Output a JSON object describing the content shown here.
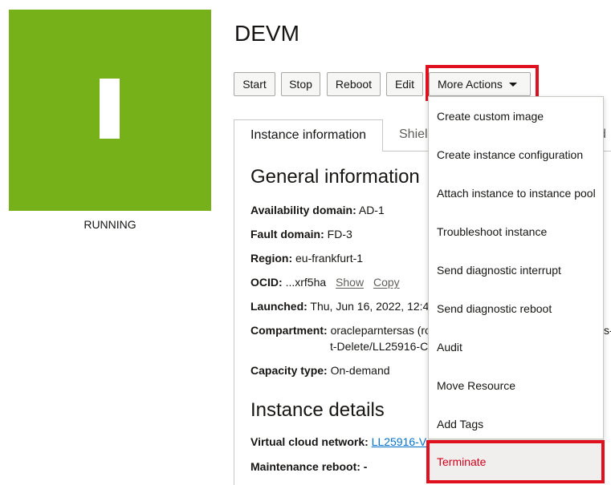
{
  "colors": {
    "status_tile": "#76b11a",
    "highlight": "#e0101e",
    "danger": "#d1001e",
    "link": "#0572ce"
  },
  "instance": {
    "title": "DEVM",
    "status": "RUNNING",
    "status_icon": "instance-running-icon"
  },
  "toolbar": {
    "start": "Start",
    "stop": "Stop",
    "reboot": "Reboot",
    "edit": "Edit",
    "more_actions": "More Actions",
    "more_actions_icon": "caret-down-icon"
  },
  "tabs": {
    "active": "Instance information",
    "second": "Shiel",
    "third": "d"
  },
  "general": {
    "heading": "General information",
    "availability_domain_label": "Availability domain:",
    "availability_domain": "AD-1",
    "fault_domain_label": "Fault domain:",
    "fault_domain": "FD-3",
    "region_label": "Region:",
    "region": "eu-frankfurt-1",
    "ocid_label": "OCID:",
    "ocid": "...xrf5ha",
    "ocid_show": "Show",
    "ocid_copy": "Copy",
    "launched_label": "Launched:",
    "launched": "Thu, Jun 16, 2022, 12:4",
    "compartment_label": "Compartment:",
    "compartment_line1": "oracleparntersas (ro",
    "compartment_line2": "t-Delete/LL25916-C",
    "compartment_overflow": "s-",
    "capacity_type_label": "Capacity type:",
    "capacity_type": "On-demand"
  },
  "details": {
    "heading": "Instance details",
    "vcn_label": "Virtual cloud network:",
    "vcn": "LL25916-V",
    "maintenance_label": "Maintenance reboot:",
    "maintenance": "-"
  },
  "menu": {
    "items": [
      "Create custom image",
      "Create instance configuration",
      "Attach instance to instance pool",
      "Troubleshoot instance",
      "Send diagnostic interrupt",
      "Send diagnostic reboot",
      "Audit",
      "Move Resource",
      "Add Tags"
    ],
    "terminate": "Terminate"
  }
}
